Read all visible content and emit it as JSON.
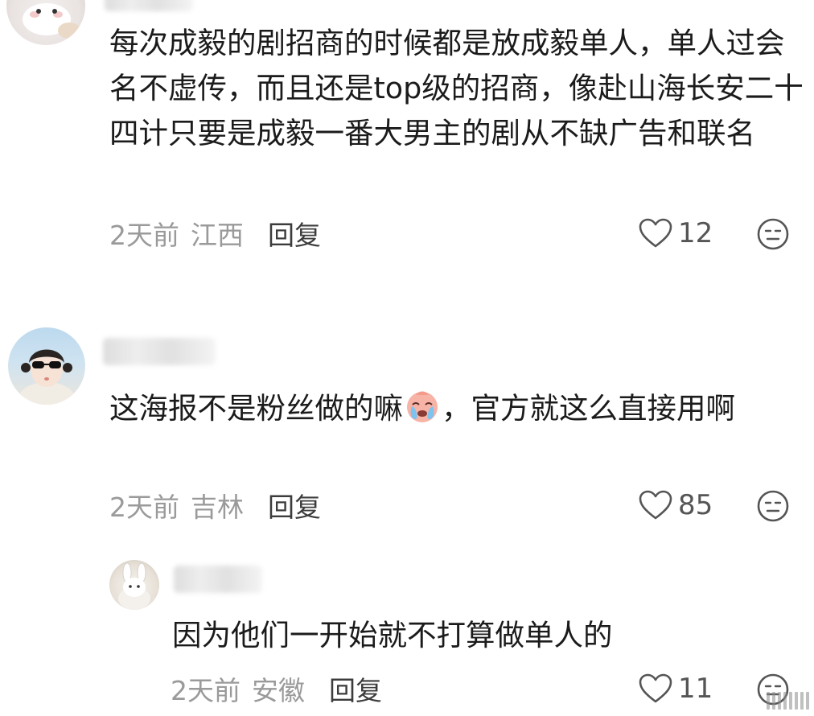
{
  "comments": [
    {
      "text": "每次成毅的剧招商的时候都是放成毅单人，单人过会名不虚传，而且还是top级的招商，像赴山海长安二十四计只要是成毅一番大男主的剧从不缺广告和联名",
      "time": "2天前",
      "region": "江西",
      "reply_label": "回复",
      "likes": "12"
    },
    {
      "text_before_emoji": "这海报不是粉丝做的嘛",
      "emoji": "crying-face-emoji",
      "text_after_emoji": "，官方就这么直接用啊",
      "time": "2天前",
      "region": "吉林",
      "reply_label": "回复",
      "likes": "85"
    },
    {
      "text": "因为他们一开始就不打算做单人的",
      "time": "2天前",
      "region": "安徽",
      "reply_label": "回复",
      "likes": "11"
    }
  ],
  "icons": {
    "like": "heart-outline-icon",
    "dislike": "neutral-face-icon"
  },
  "colors": {
    "text": "#1b1b1b",
    "meta": "#9a9a9a",
    "reply": "#3c3c3c",
    "icon": "#555555"
  }
}
